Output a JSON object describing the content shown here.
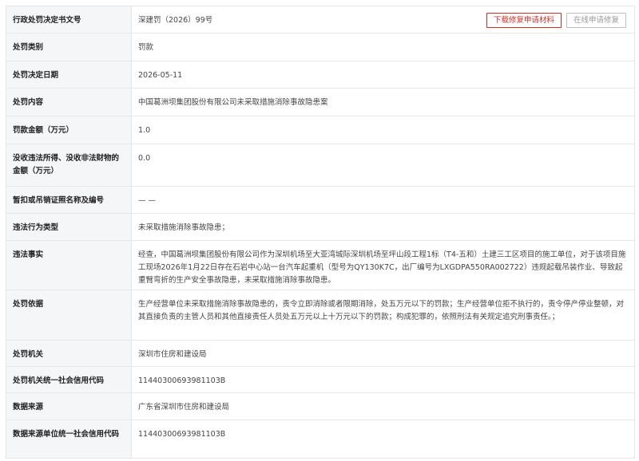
{
  "accent": "#c9302c",
  "rows": {
    "decision_no": {
      "label": "行政处罚决定书文号",
      "value": "深建罚（2026）99号"
    },
    "category": {
      "label": "处罚类别",
      "value": "罚款"
    },
    "date": {
      "label": "处罚决定日期",
      "value": "2026-05-11"
    },
    "content": {
      "label": "处罚内容",
      "value": "中国葛洲坝集团股份有限公司未采取措施消除事故隐患案"
    },
    "amount": {
      "label": "罚款金额（万元）",
      "value": "1.0"
    },
    "confiscated": {
      "label": "没收违法所得、没收非法财物的金额（万元）",
      "value": "0.0"
    },
    "license": {
      "label": "暂扣或吊销证照名称及编号",
      "value": "— —"
    },
    "violation_type": {
      "label": "违法行为类型",
      "value": "未采取措施消除事故隐患；"
    },
    "facts": {
      "label": "违法事实",
      "value": "经查，中国葛洲坝集团股份有限公司作为深圳机场至大亚湾城际深圳机场至坪山段工程1标（T4-五和）土建三工区项目的施工单位，对于该项目施工现场2026年1月22日存在石岩中心站一台汽车起重机（型号为QY130K7C，出厂编号为LXGDPA550RA002722）违规起载吊装作业、导致起重臂弯折的生产安全事故隐患，未采取措施消除事故隐患。"
    },
    "basis": {
      "label": "处罚依据",
      "value": "生产经营单位未采取措施消除事故隐患的，责令立即消除或者限期消除，处五万元以下的罚款；生产经营单位拒不执行的，责令停产停业整顿，对其直接负责的主管人员和其他直接责任人员处五万元以上十万元以下的罚款；构成犯罪的，依照刑法有关规定追究刑事责任。；"
    },
    "authority": {
      "label": "处罚机关",
      "value": "深圳市住房和建设局"
    },
    "authority_code": {
      "label": "处罚机关统一社会信用代码",
      "value": "11440300693981103B"
    },
    "source": {
      "label": "数据来源",
      "value": "广东省深圳市住房和建设局"
    },
    "source_code": {
      "label": "数据来源单位统一社会信用代码",
      "value": "11440300693981103B"
    }
  },
  "buttons": {
    "download": "下载修复申请材料",
    "online_repair": "在线申请修复"
  }
}
